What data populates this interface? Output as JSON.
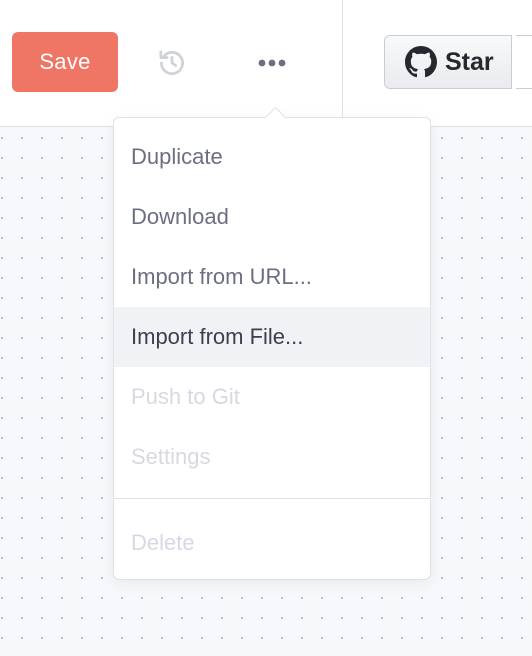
{
  "toolbar": {
    "save_label": "Save",
    "history_icon": "history-icon",
    "more_icon": "more-horizontal-icon",
    "save_color": "#ef7565"
  },
  "github": {
    "icon": "github-icon",
    "star_label": "Star"
  },
  "menu": {
    "items": [
      {
        "label": "Duplicate",
        "state": "enabled"
      },
      {
        "label": "Download",
        "state": "enabled"
      },
      {
        "label": "Import from URL...",
        "state": "enabled"
      },
      {
        "label": "Import from File...",
        "state": "hover"
      },
      {
        "label": "Push to Git",
        "state": "disabled"
      },
      {
        "label": "Settings",
        "state": "disabled"
      }
    ],
    "danger_item": {
      "label": "Delete",
      "state": "disabled"
    }
  }
}
